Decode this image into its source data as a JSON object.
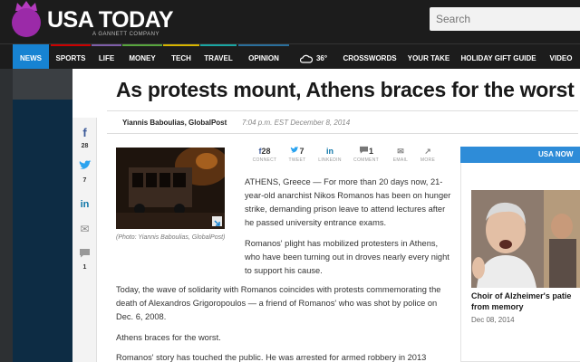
{
  "header": {
    "logo_text": "USA TODAY",
    "logo_sub": "A GANNETT COMPANY",
    "search_placeholder": "Search"
  },
  "nav": {
    "items": [
      {
        "label": "NEWS",
        "active": true
      },
      {
        "label": "SPORTS"
      },
      {
        "label": "LIFE"
      },
      {
        "label": "MONEY"
      },
      {
        "label": "TECH"
      },
      {
        "label": "TRAVEL"
      },
      {
        "label": "OPINION"
      },
      {
        "label": "36°",
        "icon": "weather-cloud-icon"
      },
      {
        "label": "CROSSWORDS"
      },
      {
        "label": "YOUR TAKE"
      },
      {
        "label": "HOLIDAY GIFT GUIDE"
      },
      {
        "label": "VIDEO"
      }
    ],
    "accent_colors": [
      "#1783d2",
      "#cc0000",
      "#7e5ea8",
      "#58a53e",
      "#d6b400",
      "#1aa6a3",
      "#2a6f9c"
    ]
  },
  "article": {
    "headline": "As protests mount, Athens braces for the worst",
    "author": "Yiannis Baboulias, GlobalPost",
    "timestamp": "7:04 p.m. EST December 8, 2014",
    "photo_caption": "(Photo: Yiannis Baboulias, GlobalPost)",
    "paragraphs": [
      "ATHENS, Greece — For more than 20 days now, 21-year-old anarchist Nikos Romanos has been on hunger strike, demanding prison leave to attend lectures after he passed university entrance exams.",
      "Romanos' plight has mobilized protesters in Athens, who have been turning out in droves nearly every night to support his cause.",
      "Today, the wave of solidarity with Romanos coincides with protests commemorating the death of Alexandros Grigoropoulos — a friend of Romanos' who was shot by police on Dec. 6, 2008.",
      "Athens braces for the worst.",
      "Romanos' story has touched the public. He was arrested for armed robbery in 2013"
    ]
  },
  "social": {
    "items": [
      {
        "icon": "facebook-icon",
        "glyph": "f",
        "count": "28",
        "label": "CONNECT"
      },
      {
        "icon": "twitter-icon",
        "glyph": "🐦",
        "count": "7",
        "label": "TWEET"
      },
      {
        "icon": "linkedin-icon",
        "glyph": "in",
        "count": "",
        "label": "LINKEDIN"
      },
      {
        "icon": "comment-icon",
        "glyph": "💬",
        "count": "1",
        "label": "COMMENT"
      },
      {
        "icon": "email-icon",
        "glyph": "✉",
        "count": "",
        "label": "EMAIL"
      },
      {
        "icon": "more-icon",
        "glyph": "↗",
        "count": "",
        "label": "MORE"
      }
    ]
  },
  "rail": {
    "items": [
      {
        "icon": "facebook-icon",
        "glyph": "f",
        "count": "28"
      },
      {
        "icon": "twitter-icon",
        "glyph": "🐦",
        "count": "7"
      },
      {
        "icon": "linkedin-icon",
        "glyph": "in",
        "count": ""
      },
      {
        "icon": "email-icon",
        "glyph": "✉",
        "count": ""
      },
      {
        "icon": "comment-icon",
        "glyph": "💬",
        "count": "1"
      }
    ]
  },
  "widget": {
    "banner": "USA NOW",
    "title": "Choir of Alzheimer's patie",
    "title_line2": "from memory",
    "date": "Dec 08, 2014"
  }
}
